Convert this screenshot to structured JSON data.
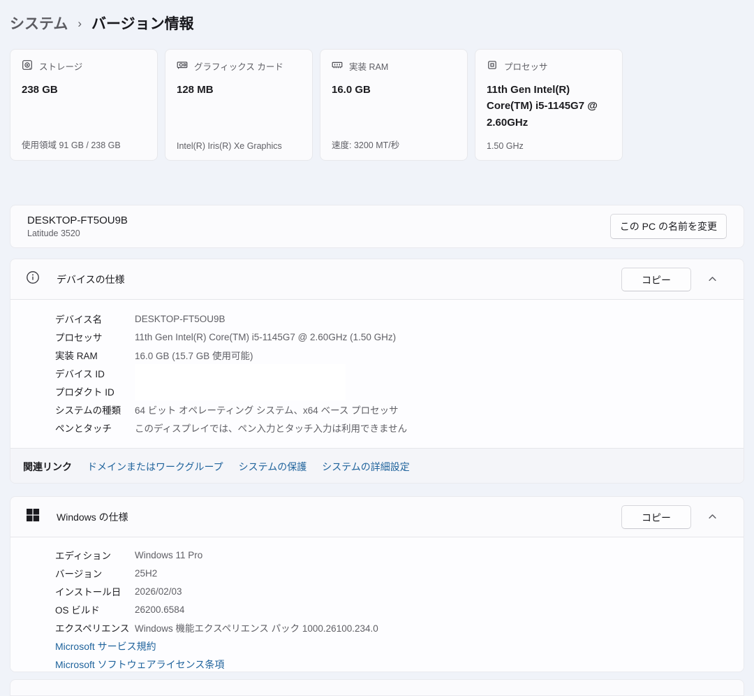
{
  "breadcrumb": {
    "parent": "システム",
    "separator": "›",
    "current": "バージョン情報"
  },
  "cards": [
    {
      "icon": "storage-icon",
      "label": "ストレージ",
      "value": "238 GB",
      "detail": "使用領域 91 GB / 238 GB"
    },
    {
      "icon": "graphics-card-icon",
      "label": "グラフィックス カード",
      "value": "128 MB",
      "detail": "Intel(R) Iris(R) Xe Graphics"
    },
    {
      "icon": "ram-icon",
      "label": "実装 RAM",
      "value": "16.0 GB",
      "detail": "速度: 3200 MT/秒"
    },
    {
      "icon": "processor-icon",
      "label": "プロセッサ",
      "value": "11th Gen Intel(R) Core(TM) i5-1145G7 @ 2.60GHz",
      "detail": "1.50 GHz"
    }
  ],
  "device_name_card": {
    "name": "DESKTOP-FT5OU9B",
    "model": "Latitude 3520",
    "rename_button": "この PC の名前を変更"
  },
  "device_specs": {
    "icon": "info-icon",
    "title": "デバイスの仕様",
    "copy_button": "コピー",
    "expand_state_icon": "chevron-up-icon",
    "rows": [
      {
        "label": "デバイス名",
        "value": "DESKTOP-FT5OU9B"
      },
      {
        "label": "プロセッサ",
        "value": "11th Gen Intel(R) Core(TM) i5-1145G7 @ 2.60GHz (1.50 GHz)"
      },
      {
        "label": "実装 RAM",
        "value": "16.0 GB (15.7 GB 使用可能)"
      },
      {
        "label": "デバイス ID",
        "value": "",
        "redacted": true
      },
      {
        "label": "プロダクト ID",
        "value": "",
        "redacted": true
      },
      {
        "label": "システムの種類",
        "value": "64 ビット オペレーティング システム、x64 ベース プロセッサ"
      },
      {
        "label": "ペンとタッチ",
        "value": "このディスプレイでは、ペン入力とタッチ入力は利用できません"
      }
    ],
    "related_links": {
      "label": "関連リンク",
      "links": [
        "ドメインまたはワークグループ",
        "システムの保護",
        "システムの詳細設定"
      ]
    }
  },
  "windows_specs": {
    "icon": "windows-logo-icon",
    "title": "Windows の仕様",
    "copy_button": "コピー",
    "expand_state_icon": "chevron-up-icon",
    "rows": [
      {
        "label": "エディション",
        "value": "Windows 11 Pro"
      },
      {
        "label": "バージョン",
        "value": "25H2"
      },
      {
        "label": "インストール日",
        "value": "2026/02/03"
      },
      {
        "label": "OS ビルド",
        "value": "26200.6584"
      },
      {
        "label": "エクスペリエンス",
        "value": "Windows 機能エクスペリエンス パック 1000.26100.234.0"
      }
    ],
    "links": [
      "Microsoft サービス規約",
      "Microsoft ソフトウェアライセンス条項"
    ]
  },
  "colors": {
    "link": "#1f639c",
    "page_background": "#f0f3f9",
    "card_background": "#fbfbfd"
  }
}
